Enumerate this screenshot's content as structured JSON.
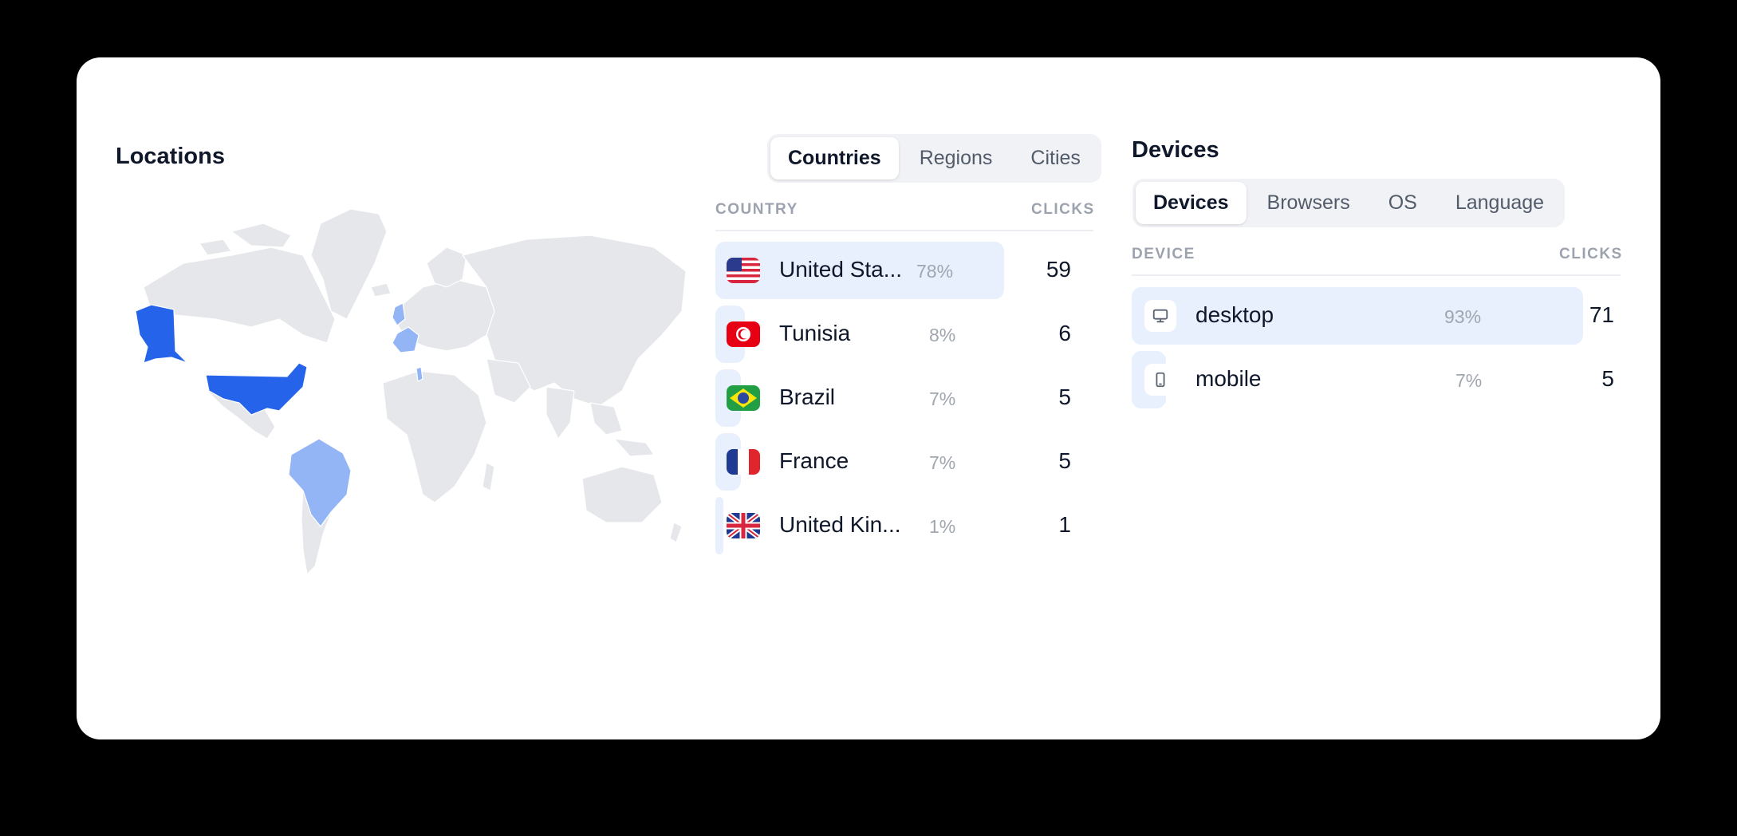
{
  "locations": {
    "title": "Locations",
    "tabs": [
      {
        "label": "Countries",
        "active": true
      },
      {
        "label": "Regions",
        "active": false
      },
      {
        "label": "Cities",
        "active": false
      }
    ],
    "columns": {
      "name": "COUNTRY",
      "count": "CLICKS"
    },
    "rows": [
      {
        "name": "United Sta...",
        "pct": "78%",
        "count": "59",
        "share": 0.78,
        "flag": "us-flag-icon"
      },
      {
        "name": "Tunisia",
        "pct": "8%",
        "count": "6",
        "share": 0.08,
        "flag": "tunisia-flag-icon"
      },
      {
        "name": "Brazil",
        "pct": "7%",
        "count": "5",
        "share": 0.07,
        "flag": "brazil-flag-icon"
      },
      {
        "name": "France",
        "pct": "7%",
        "count": "5",
        "share": 0.07,
        "flag": "france-flag-icon"
      },
      {
        "name": "United Kin...",
        "pct": "1%",
        "count": "1",
        "share": 0.01,
        "flag": "uk-flag-icon"
      }
    ],
    "map_colors": {
      "base": "#e5e7eb",
      "strong": "#2563eb",
      "light": "#93b4f5"
    }
  },
  "devices": {
    "title": "Devices",
    "tabs": [
      {
        "label": "Devices",
        "active": true
      },
      {
        "label": "Browsers",
        "active": false
      },
      {
        "label": "OS",
        "active": false
      },
      {
        "label": "Language",
        "active": false
      }
    ],
    "columns": {
      "name": "DEVICE",
      "count": "CLICKS"
    },
    "rows": [
      {
        "name": "desktop",
        "pct": "93%",
        "count": "71",
        "share": 0.93,
        "icon": "monitor-icon"
      },
      {
        "name": "mobile",
        "pct": "7%",
        "count": "5",
        "share": 0.07,
        "icon": "smartphone-icon"
      }
    ]
  },
  "colors": {
    "bar": "#e8effd",
    "accent": "#2563eb"
  }
}
